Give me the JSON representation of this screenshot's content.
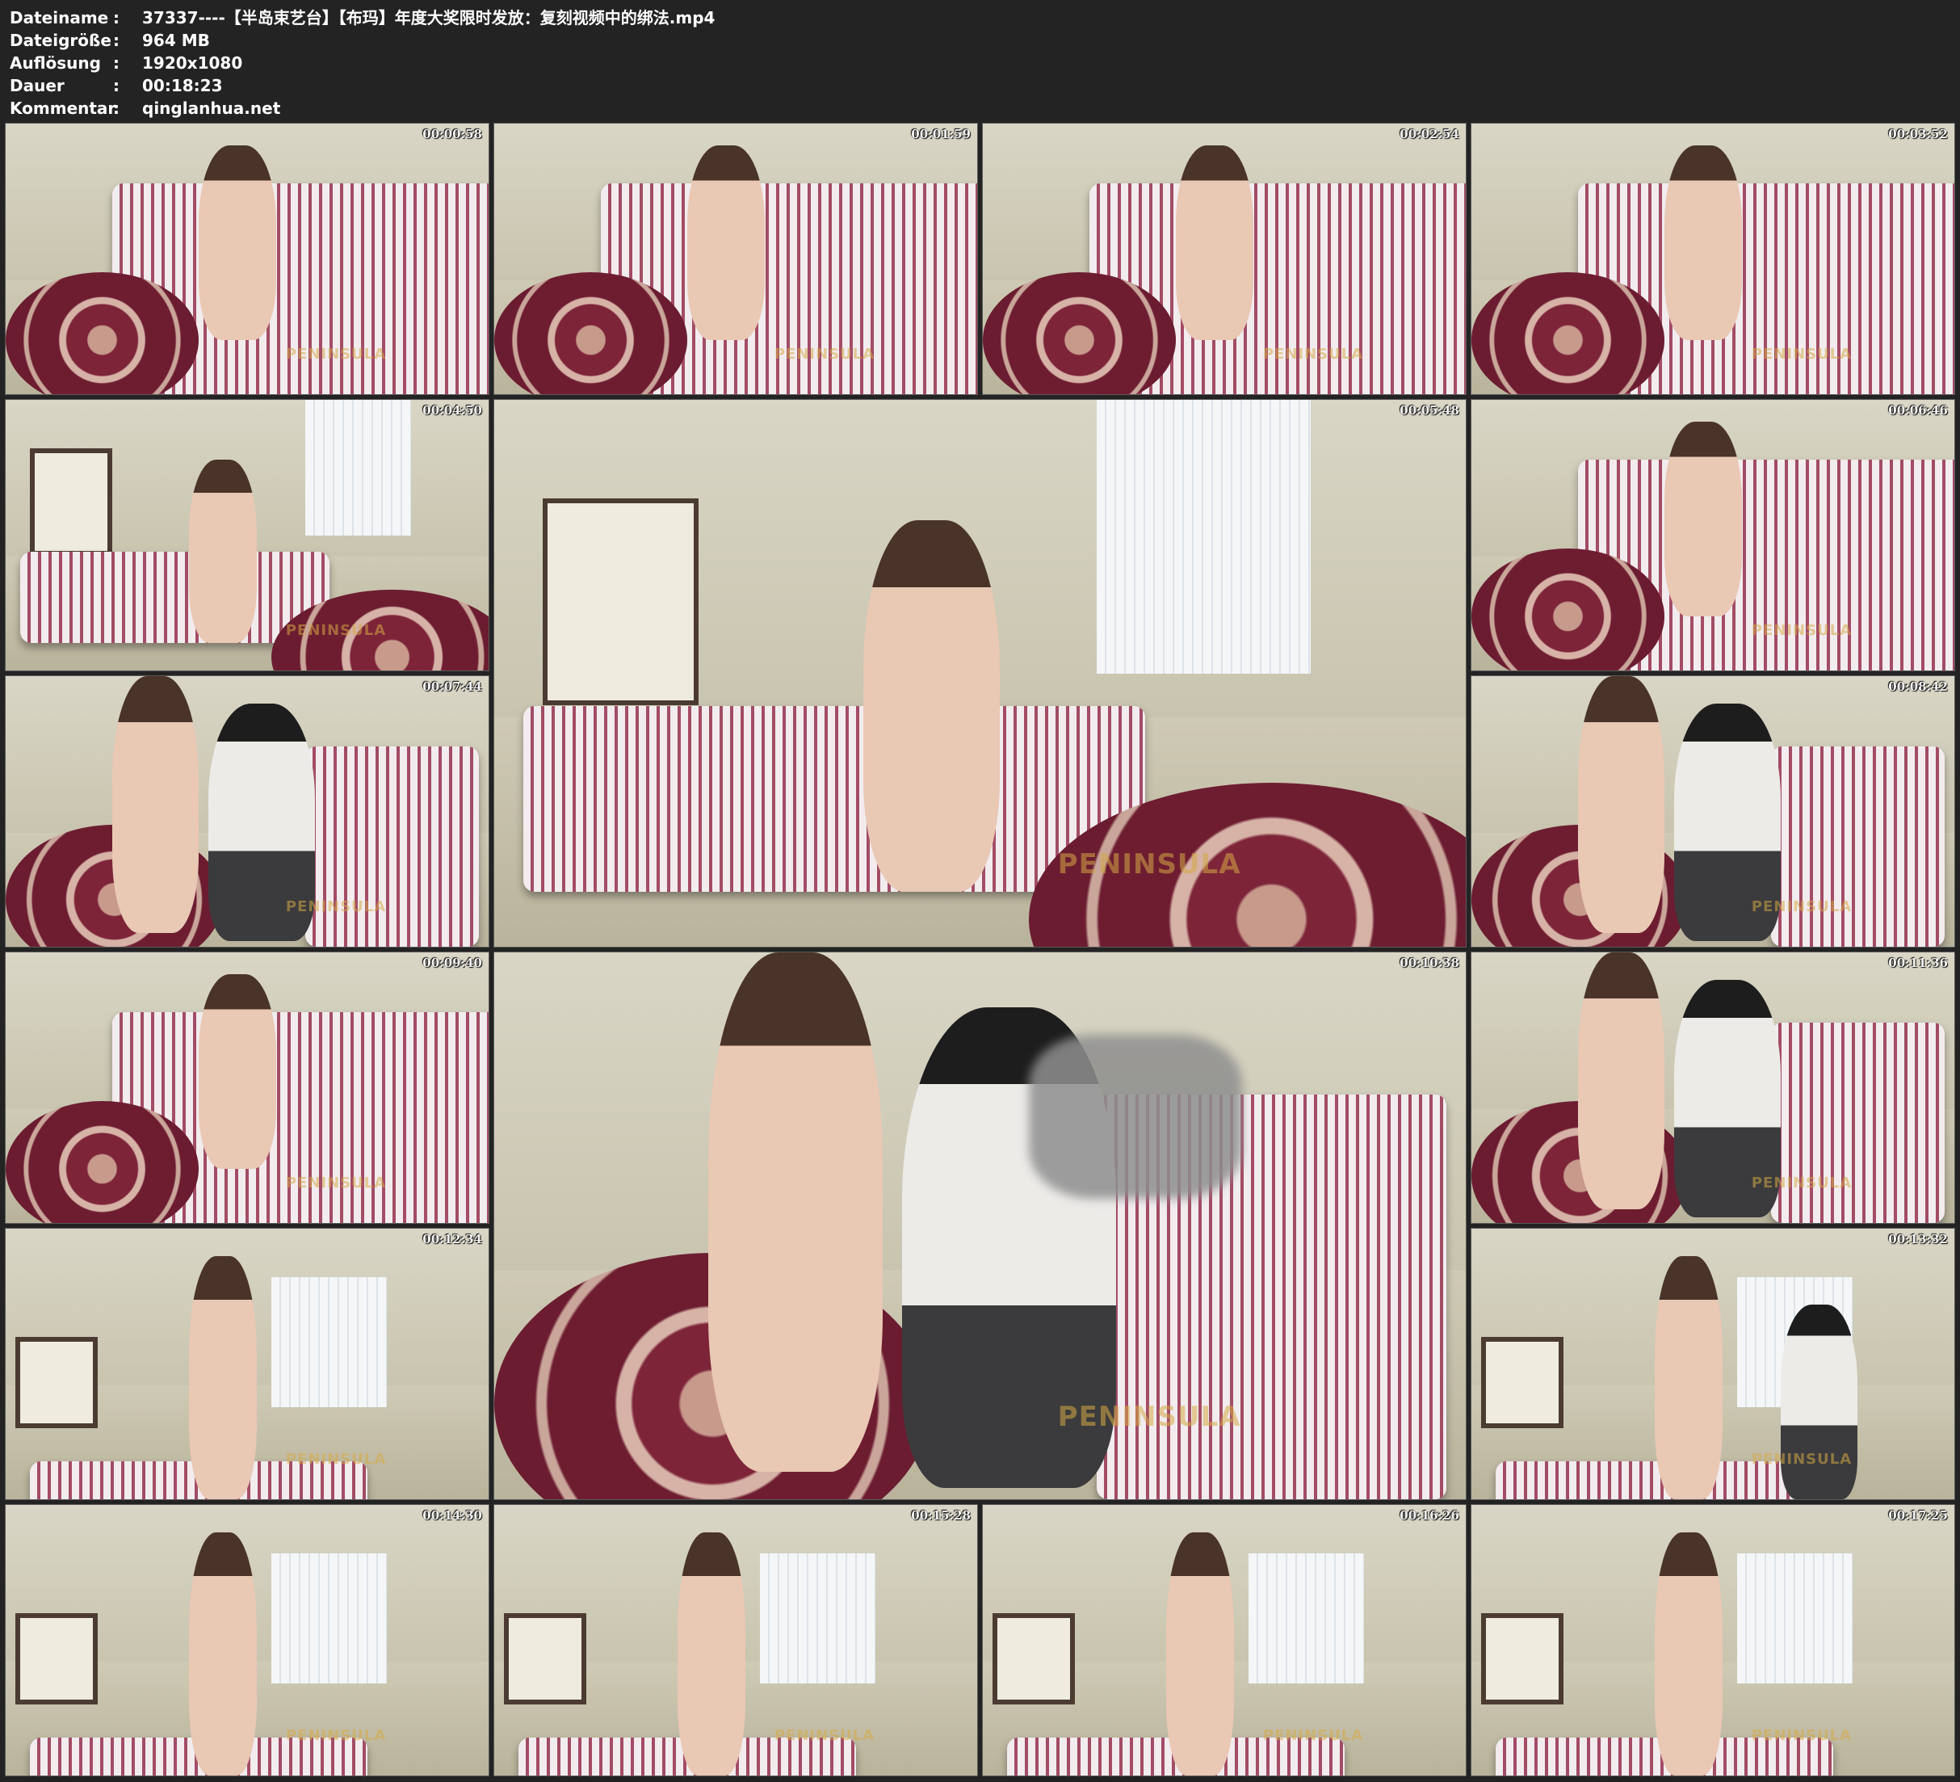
{
  "meta": {
    "filename_label": "Dateiname",
    "filename_value": "37337----【半岛束艺台】【布玛】年度大奖限时发放：复刻视频中的绑法.mp4",
    "size_label": "Dateigröße",
    "size_value": "964 MB",
    "resolution_label": "Auflösung",
    "resolution_value": "1920x1080",
    "duration_label": "Dauer",
    "duration_value": "00:18:23",
    "comment_label": "Kommentar",
    "comment_value": "qinglanhua.net",
    "separator": ":"
  },
  "frames": [
    {
      "timestamp": "00:00:58",
      "watermark": "PENINSULA",
      "scene": "sofa-wide"
    },
    {
      "timestamp": "00:01:59",
      "watermark": "PENINSULA",
      "scene": "sofa-back"
    },
    {
      "timestamp": "00:02:54",
      "watermark": "PENINSULA",
      "scene": "sofa-back"
    },
    {
      "timestamp": "00:03:52",
      "watermark": "PENINSULA",
      "scene": "sofa-back"
    },
    {
      "timestamp": "00:04:50",
      "watermark": "PENINSULA",
      "scene": "sofa-posters"
    },
    {
      "timestamp": "00:05:48",
      "watermark": "PENINSULA",
      "scene": "sofa-posters-large"
    },
    {
      "timestamp": "00:06:46",
      "watermark": "PENINSULA",
      "scene": "sofa-back"
    },
    {
      "timestamp": "00:07:44",
      "watermark": "PENINSULA",
      "scene": "two-people"
    },
    {
      "timestamp": "00:08:42",
      "watermark": "PENINSULA",
      "scene": "two-people"
    },
    {
      "timestamp": "00:09:40",
      "watermark": "PENINSULA",
      "scene": "sofa-back"
    },
    {
      "timestamp": "00:10:38",
      "watermark": "PENINSULA",
      "scene": "two-people-large"
    },
    {
      "timestamp": "00:11:36",
      "watermark": "PENINSULA",
      "scene": "two-people"
    },
    {
      "timestamp": "00:12:34",
      "watermark": "PENINSULA",
      "scene": "standing-window"
    },
    {
      "timestamp": "00:13:32",
      "watermark": "PENINSULA",
      "scene": "standing-side"
    },
    {
      "timestamp": "00:14:30",
      "watermark": "PENINSULA",
      "scene": "standing-window"
    },
    {
      "timestamp": "00:15:28",
      "watermark": "PENINSULA",
      "scene": "standing-window"
    },
    {
      "timestamp": "00:16:26",
      "watermark": "PENINSULA",
      "scene": "standing-window"
    },
    {
      "timestamp": "00:17:25",
      "watermark": "PENINSULA",
      "scene": "standing-window"
    }
  ],
  "colors": {
    "background": "#232323",
    "text": "#ffffff",
    "sofa_stripe": "#a34c65",
    "rug": "#7d2439"
  }
}
